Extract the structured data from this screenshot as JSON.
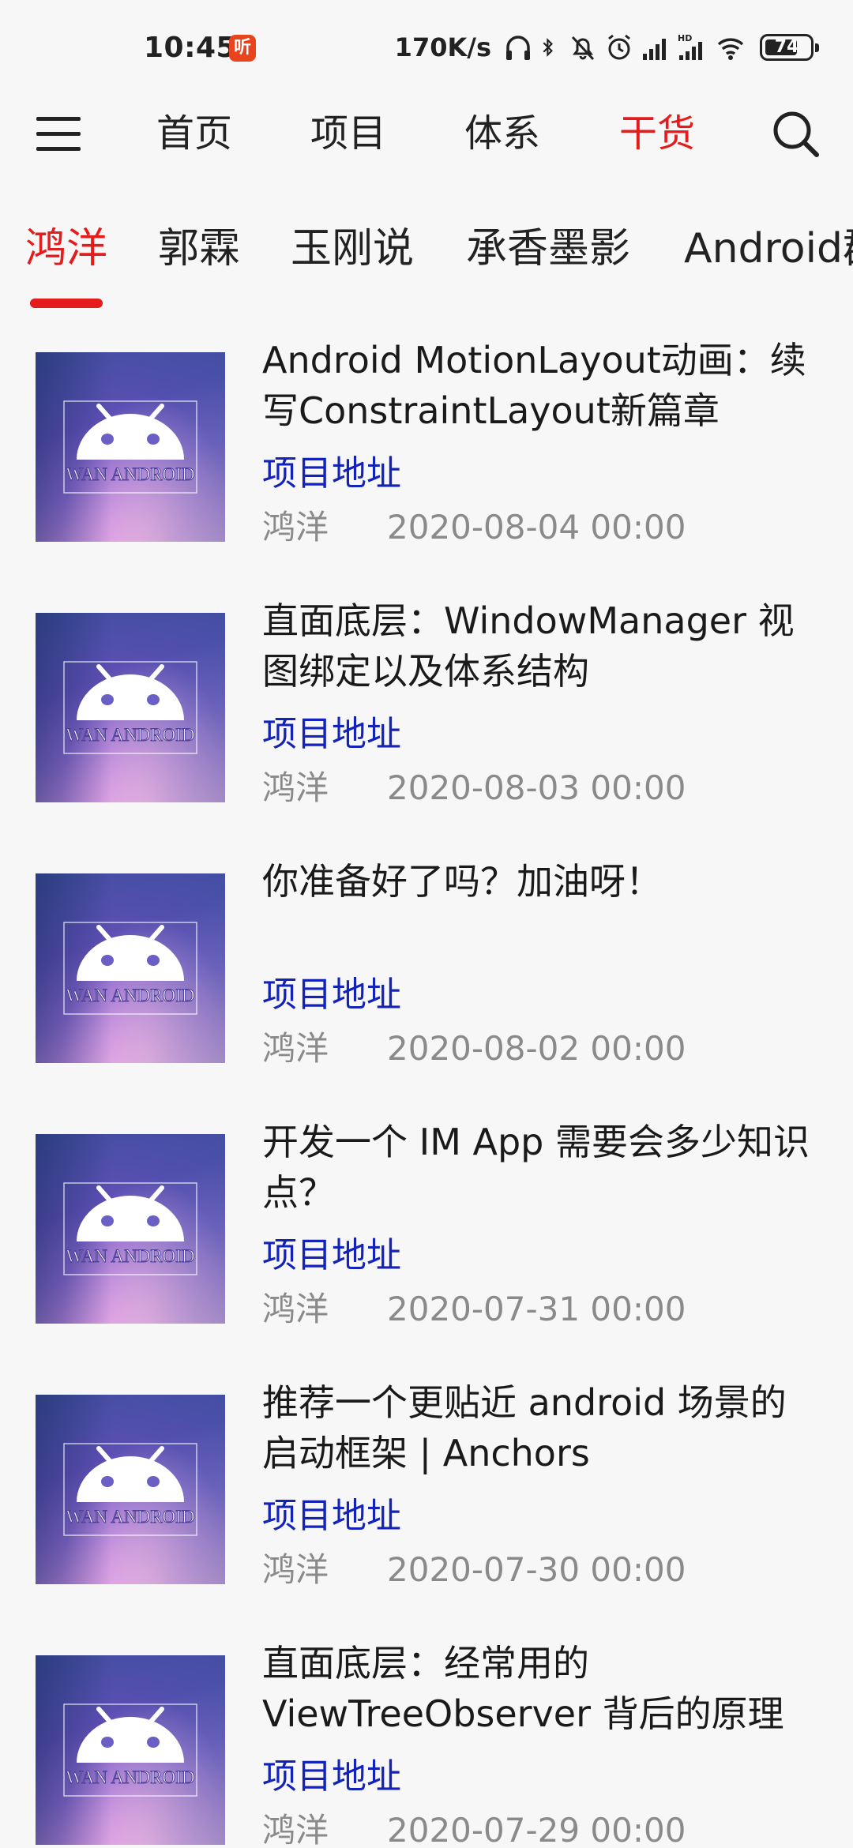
{
  "status_bar": {
    "time": "10:45",
    "app_badge": "听",
    "network_speed": "170K/s",
    "battery": "74",
    "battery_level": 0.74
  },
  "top_nav": {
    "tabs": [
      {
        "label": "首页",
        "active": false
      },
      {
        "label": "项目",
        "active": false
      },
      {
        "label": "体系",
        "active": false
      },
      {
        "label": "干货",
        "active": true
      }
    ],
    "accent_color": "#e61b1b"
  },
  "sub_tabs": [
    {
      "label": "鸿洋",
      "active": true
    },
    {
      "label": "郭霖",
      "active": false
    },
    {
      "label": "玉刚说",
      "active": false
    },
    {
      "label": "承香墨影",
      "active": false
    },
    {
      "label": "Android群英传",
      "active": false
    }
  ],
  "thumbnail_text": "WAN ANDROID",
  "articles": [
    {
      "title": "Android MotionLayout动画：续写ConstraintLayout新篇章",
      "link_label": "项目地址",
      "author": "鸿洋",
      "date": "2020-08-04 00:00"
    },
    {
      "title": "直面底层：WindowManager 视图绑定以及体系结构",
      "link_label": "项目地址",
      "author": "鸿洋",
      "date": "2020-08-03 00:00"
    },
    {
      "title": "你准备好了吗？加油呀！",
      "link_label": "项目地址",
      "author": "鸿洋",
      "date": "2020-08-02 00:00"
    },
    {
      "title": "开发一个 IM App 需要会多少知识点？",
      "link_label": "项目地址",
      "author": "鸿洋",
      "date": "2020-07-31 00:00"
    },
    {
      "title": "推荐一个更贴近 android 场景的启动框架 | Anchors",
      "link_label": "项目地址",
      "author": "鸿洋",
      "date": "2020-07-30 00:00"
    },
    {
      "title": "直面底层：经常用的 ViewTreeObserver 背后的原理",
      "link_label": "项目地址",
      "author": "鸿洋",
      "date": "2020-07-29 00:00"
    }
  ]
}
